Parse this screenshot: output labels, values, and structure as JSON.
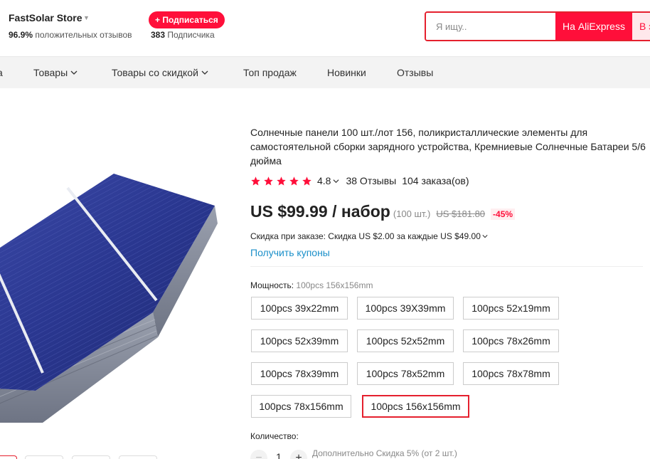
{
  "store": {
    "name": "FastSolar Store",
    "rating_percent": "96.9%",
    "rating_text": "положительных отзывов",
    "subscribe_label": "+ Подписаться",
    "subscribers_count": "383",
    "subscribers_text": "Подписчика"
  },
  "search": {
    "placeholder": "Я ищу..",
    "value": "",
    "aliexpress_button": "На AliExpress",
    "store_button": "В этом магазине"
  },
  "nav": {
    "items": [
      {
        "label": "а",
        "has_caret": false
      },
      {
        "label": "Товары",
        "has_caret": true
      },
      {
        "label": "Товары со скидкой",
        "has_caret": true
      },
      {
        "label": "Топ продаж",
        "has_caret": false
      },
      {
        "label": "Новинки",
        "has_caret": false
      },
      {
        "label": "Отзывы",
        "has_caret": false
      }
    ]
  },
  "product": {
    "title": "Солнечные панели 100 шт./лот 156, поликристаллические элементы для самостоятельной сборки зарядного устройства, Кремниевые Солнечные Батареи 5/6 дюйма",
    "stars": 5,
    "rating": "4.8",
    "reviews": "38 Отзывы",
    "orders": "104 заказа(ов)",
    "price": "US $99.99 / набор",
    "price_unit": "(100 шт.)",
    "old_price": "US $181.80",
    "discount": "-45%",
    "order_discount": "Скидка при заказе: Скидка US $2.00 за каждые US $49.00",
    "coupons_link": "Получить купоны",
    "power_label": "Мощность:",
    "power_selected": "100pcs 156x156mm",
    "options": [
      "100pcs 39x22mm",
      "100pcs 39X39mm",
      "100pcs 52x19mm",
      "100pcs 52x39mm",
      "100pcs 52x52mm",
      "100pcs 78x26mm",
      "100pcs 78x39mm",
      "100pcs 78x52mm",
      "100pcs 78x78mm",
      "100pcs 78x156mm",
      "100pcs 156x156mm"
    ],
    "selected_option_index": 10,
    "quantity_label": "Количество:",
    "quantity": "1",
    "quantity_minus": "−",
    "quantity_plus": "+",
    "quantity_note": "Дополнительно Скидка 5% (от 2 шт.)"
  },
  "colors": {
    "accent": "#ff0f3a",
    "link": "#1a8fc9",
    "nav_bg": "#f3f3f3"
  }
}
